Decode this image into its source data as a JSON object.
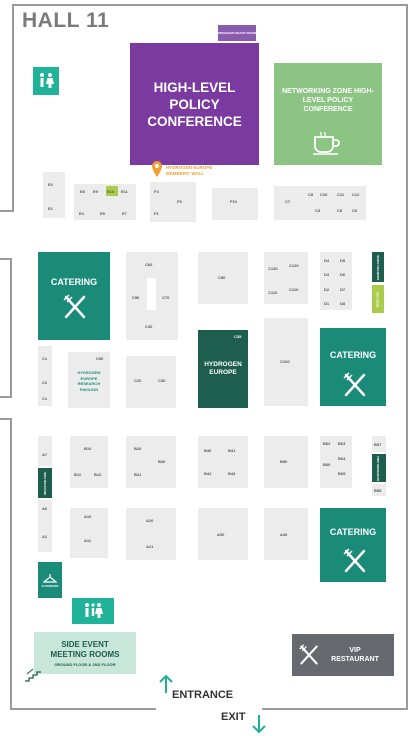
{
  "title": "HALL 11",
  "colors": {
    "purple": "#7b3aa0",
    "teal": "#1a8a79",
    "dark_green": "#1d5e4e",
    "light_green": "#8bc483",
    "lime": "#a9cc4b",
    "stand_gray": "#ececec",
    "wall": "#9a9a9a",
    "vip": "#666a6f",
    "side_event": "#c8e6da",
    "pin": "#f0a032"
  },
  "areas": {
    "policy_conf": "HIGH-LEVEL POLICY CONFERENCE",
    "speaker_room": "SPEAKERS READY ROOM",
    "networking": "NETWORKING ZONE HIGH-LEVEL POLICY CONFERENCE",
    "members_wall": "HYDROGEN EUROPE MEMBERS' WALL",
    "catering": "CATERING",
    "hydrogen_europe": "HYDROGEN EUROPE",
    "research": "HYDROGEN EUROPE RESEARCH PAVILION",
    "side_event_title": "SIDE EVENT MEETING ROOMS",
    "side_event_sub": "GROUND FLOOR & 2ND FLOOR",
    "vip": "VIP RESTAURANT",
    "entrance": "ENTRANCE",
    "exit": "EXIT",
    "vert_1": "EXHIBITOR LOUNGE",
    "vert_2": "MEDIA ZONE",
    "vert_3": "INNOVATION ZONE",
    "vert_4": "NETWORKING AREA",
    "vert_5": "INFO POINT",
    "cloakroom": "CLOAKROOM"
  },
  "stands": {
    "E2": "E2",
    "E1": "E1",
    "E8": "E8",
    "E9": "E9",
    "E10": "E10",
    "E11": "E11",
    "E4": "E4",
    "E5": "E5",
    "E7": "E7",
    "F4": "F4",
    "F1": "F1",
    "F5": "F5",
    "F10": "F10",
    "C7": "C7",
    "C8": "C8",
    "C10": "C10",
    "C11": "C11",
    "C12": "C12",
    "C3": "C3",
    "C5": "C5",
    "C6": "C6",
    "C60": "C60",
    "C50": "C50",
    "C70": "C70",
    "C40": "C40",
    "C80": "C80",
    "C130": "C130",
    "C120": "C120",
    "C110": "C110",
    "C110b": "C110",
    "D4": "D4",
    "D5": "D5",
    "D3": "D3",
    "D6": "D6",
    "D2": "D2",
    "D7": "D7",
    "D1": "D1",
    "D8": "D8",
    "C1a": "C1",
    "C2": "C2",
    "C1": "C1",
    "C90": "C90",
    "C20": "C20",
    "C30": "C30",
    "C35": "C35",
    "C100": "C100",
    "A7": "A7",
    "A6": "A6",
    "A1": "A1",
    "B10": "B10",
    "B11": "B11",
    "B12": "B12",
    "B20": "B20",
    "B30": "B30",
    "B21": "B21",
    "B40": "B40",
    "B41": "B41",
    "B42": "B42",
    "B43": "B43",
    "B50": "B50",
    "B62": "B62",
    "B63": "B63",
    "B60": "B60",
    "B64": "B64",
    "B65": "B65",
    "B57": "B57",
    "B55": "B55",
    "A10": "A10",
    "A11": "A11",
    "A20": "A20",
    "A21": "A21",
    "A30": "A30",
    "A40": "A40"
  }
}
